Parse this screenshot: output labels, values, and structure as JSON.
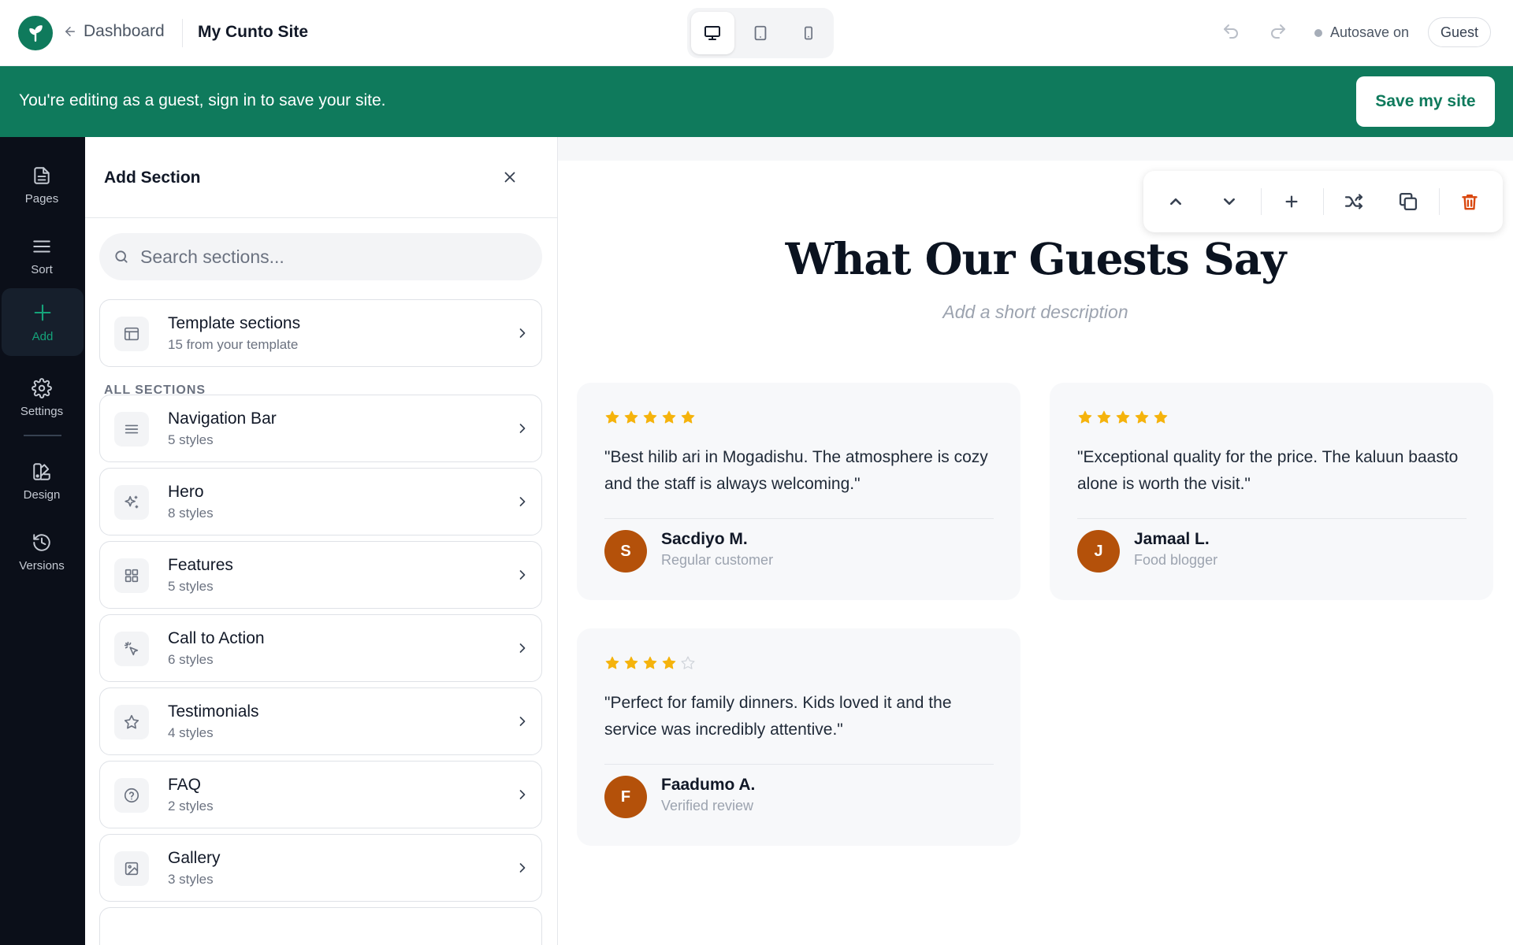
{
  "app": {
    "back_label": "Dashboard",
    "site_name": "My Cunto Site",
    "autosave_label": "Autosave on",
    "guest_label": "Guest",
    "devices": [
      "desktop-icon",
      "tablet-icon",
      "mobile-icon"
    ],
    "active_device": "desktop"
  },
  "banner": {
    "text": "You're editing as a guest, sign in to save your site.",
    "save_label": "Save my site"
  },
  "rail": {
    "items": [
      {
        "label": "Pages",
        "icon": "file-icon"
      },
      {
        "label": "Sort",
        "icon": "menu-icon"
      },
      {
        "label": "Add",
        "icon": "plus-icon",
        "active": true
      },
      {
        "label": "Settings",
        "icon": "gear-icon"
      },
      {
        "label": "Design",
        "icon": "palette-icon"
      },
      {
        "label": "Versions",
        "icon": "history-icon"
      }
    ]
  },
  "panel": {
    "title": "Add Section",
    "search_placeholder": "Search sections...",
    "template": {
      "title": "Template sections",
      "subtitle": "15 from your template"
    },
    "all_label": "ALL SECTIONS",
    "sections": [
      {
        "title": "Navigation Bar",
        "subtitle": "5 styles",
        "icon": "menu-icon"
      },
      {
        "title": "Hero",
        "subtitle": "8 styles",
        "icon": "sparkles-icon"
      },
      {
        "title": "Features",
        "subtitle": "5 styles",
        "icon": "grid-icon"
      },
      {
        "title": "Call to Action",
        "subtitle": "6 styles",
        "icon": "pointer-click-icon"
      },
      {
        "title": "Testimonials",
        "subtitle": "4 styles",
        "icon": "star-icon"
      },
      {
        "title": "FAQ",
        "subtitle": "2 styles",
        "icon": "help-circle-icon"
      },
      {
        "title": "Gallery",
        "subtitle": "3 styles",
        "icon": "image-icon"
      }
    ]
  },
  "section": {
    "heading": "What Our Guests Say",
    "description": "Add a short description"
  },
  "reviews": [
    {
      "rating": 5,
      "quote": "\"Best hilib ari in Mogadishu. The atmosphere is cozy and the staff is always welcoming.\"",
      "initial": "S",
      "name": "Sacdiyo M.",
      "role": "Regular customer"
    },
    {
      "rating": 5,
      "quote": "\"Exceptional quality for the price. The kaluun baasto alone is worth the visit.\"",
      "initial": "J",
      "name": "Jamaal L.",
      "role": "Food blogger"
    },
    {
      "rating": 4,
      "quote": "\"Perfect for family dinners. Kids loved it and the service was incredibly attentive.\"",
      "initial": "F",
      "name": "Faadumo A.",
      "role": "Verified review"
    }
  ],
  "colors": {
    "brand": "#0f7a5c",
    "star": "#f5b30c",
    "avatar": "#b4510a",
    "delete": "#d9480f"
  }
}
